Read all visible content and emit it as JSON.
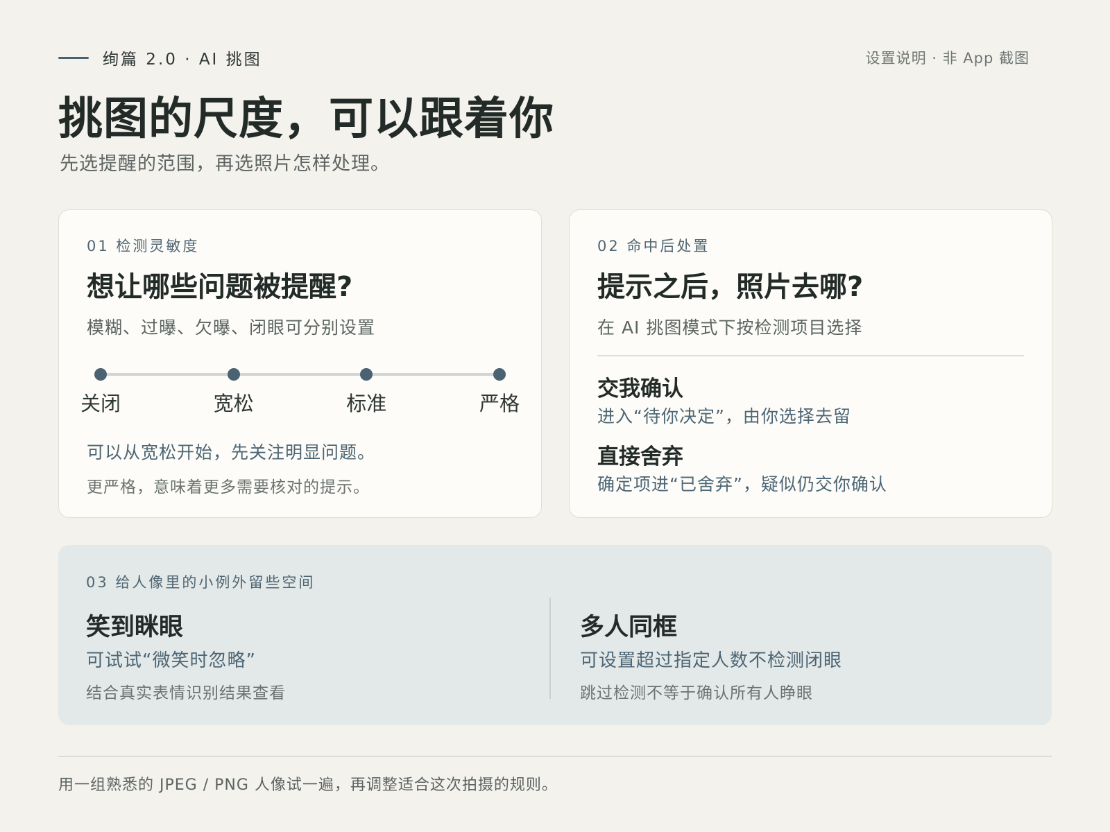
{
  "header": {
    "eyebrow": "绚篇 2.0 · AI 挑图",
    "top_right": "设置说明 · 非 App 截图",
    "title": "挑图的尺度，可以跟着你",
    "subtitle": "先选提醒的范围，再选照片怎样处理。"
  },
  "sensitivity": {
    "kicker": "01 检测灵敏度",
    "title": "想让哪些问题被提醒?",
    "description": "模糊、过曝、欠曝、闭眼可分别设置",
    "slider": {
      "stops": [
        "关闭",
        "宽松",
        "标准",
        "严格"
      ]
    },
    "note_main": "可以从宽松开始，先关注明显问题。",
    "note_sub": "更严格，意味着更多需要核对的提示。"
  },
  "handling": {
    "kicker": "02 命中后处置",
    "title": "提示之后，照片去哪?",
    "description": "在 AI 挑图模式下按检测项目选择",
    "options": [
      {
        "title": "交我确认",
        "description": "进入“待你决定”，由你选择去留"
      },
      {
        "title": "直接舍弃",
        "description": "确定项进“已舍弃”，疑似仍交你确认"
      }
    ]
  },
  "exceptions": {
    "kicker": "03 给人像里的小例外留些空间",
    "items": [
      {
        "title": "笑到眯眼",
        "description": "可试试“微笑时忽略”",
        "sub": "结合真实表情识别结果查看"
      },
      {
        "title": "多人同框",
        "description": "可设置超过指定人数不检测闭眼",
        "sub": "跳过检测不等于确认所有人睁眼"
      }
    ]
  },
  "footer": "用一组熟悉的 JPEG / PNG 人像试一遍，再调整适合这次拍摄的规则。",
  "colors": {
    "background": "#f4f2ed",
    "card": "#fdfcf8",
    "accent": "#4a6272",
    "tips_panel": "#e3e8e8"
  }
}
